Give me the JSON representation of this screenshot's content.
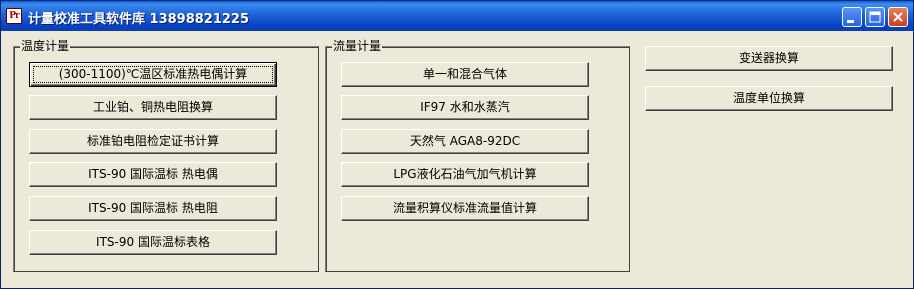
{
  "window": {
    "title": "计量校准工具软件库  13898821225",
    "icon_text": "Pr"
  },
  "temperature_group": {
    "label": "温度计量",
    "buttons": [
      "(300-1100)℃温区标准热电偶计算",
      "工业铂、铜热电阻换算",
      "标准铂电阻检定证书计算",
      "ITS-90 国际温标 热电偶",
      "ITS-90 国际温标 热电阻",
      "ITS-90 国际温标表格"
    ]
  },
  "flow_group": {
    "label": "流量计量",
    "buttons": [
      "单一和混合气体",
      "IF97 水和水蒸汽",
      "天然气 AGA8-92DC",
      "LPG液化石油气加气机计算",
      "流量积算仪标准流量值计算"
    ]
  },
  "other": {
    "transmitter_button": "变送器换算",
    "temp_unit_button": "温度单位换算"
  },
  "colors": {
    "titlebar": "#0845C9",
    "face": "#ECE9D8",
    "close_button": "#C6431E"
  },
  "icons": [
    "app-icon",
    "minimize-icon",
    "maximize-icon",
    "close-icon"
  ]
}
